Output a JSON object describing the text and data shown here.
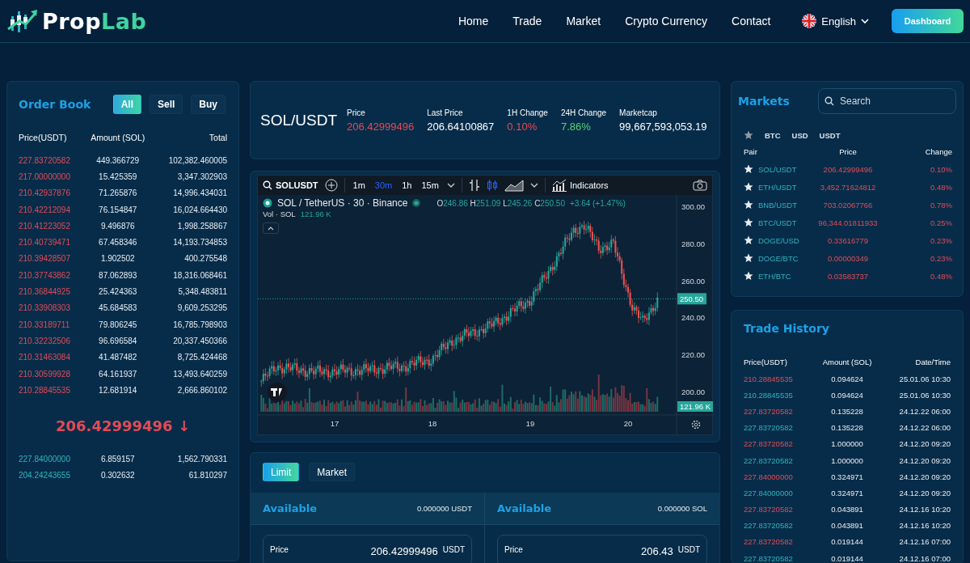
{
  "header": {
    "brand": [
      "Prop",
      "Lab"
    ],
    "nav": [
      {
        "label": "Home"
      },
      {
        "label": "Trade"
      },
      {
        "label": "Market"
      },
      {
        "label": "Crypto Currency"
      },
      {
        "label": "Contact"
      }
    ],
    "language": "English",
    "dashboard_button": "Dashboard"
  },
  "order_book": {
    "title": "Order Book",
    "filters": [
      {
        "label": "All",
        "selected": true
      },
      {
        "label": "Sell",
        "selected": false
      },
      {
        "label": "Buy",
        "selected": false
      }
    ],
    "columns": [
      "Price(USDT)",
      "Amount (SOL)",
      "Total"
    ],
    "asks": [
      {
        "price": "227.83720582",
        "amount": "449.366729",
        "total": "102,382.460005",
        "kind": "sell"
      },
      {
        "price": "217.00000000",
        "amount": "15.425359",
        "total": "3,347.302903",
        "kind": "sell"
      },
      {
        "price": "210.42937876",
        "amount": "71.265876",
        "total": "14,996.434031",
        "kind": "sell"
      },
      {
        "price": "210.42212094",
        "amount": "76.154847",
        "total": "16,024.664430",
        "kind": "sell"
      },
      {
        "price": "210.41223052",
        "amount": "9.496876",
        "total": "1,998.258867",
        "kind": "sell"
      },
      {
        "price": "210.40739471",
        "amount": "67.458346",
        "total": "14,193.734853",
        "kind": "sell"
      },
      {
        "price": "210.39428507",
        "amount": "1.902502",
        "total": "400.275548",
        "kind": "sell"
      },
      {
        "price": "210.37743862",
        "amount": "87.062893",
        "total": "18,316.068461",
        "kind": "sell"
      },
      {
        "price": "210.36844925",
        "amount": "25.424363",
        "total": "5,348.483811",
        "kind": "sell"
      },
      {
        "price": "210.33908303",
        "amount": "45.684583",
        "total": "9,609.253295",
        "kind": "sell"
      },
      {
        "price": "210.33189711",
        "amount": "79.806245",
        "total": "16,785.798903",
        "kind": "sell"
      },
      {
        "price": "210.32232506",
        "amount": "96.696584",
        "total": "20,337.450366",
        "kind": "sell"
      },
      {
        "price": "210.31463084",
        "amount": "41.487482",
        "total": "8,725.424468",
        "kind": "sell"
      },
      {
        "price": "210.30599928",
        "amount": "64.161937",
        "total": "13,493.640259",
        "kind": "sell"
      },
      {
        "price": "210.28845535",
        "amount": "12.681914",
        "total": "2,666.860102",
        "kind": "sell"
      }
    ],
    "last_price": {
      "value": "206.42999496",
      "arrow": "↓",
      "kind": "down"
    },
    "bids": [
      {
        "price": "227.84000000",
        "amount": "6.859157",
        "total": "1,562.790331",
        "kind": "buy"
      },
      {
        "price": "204.24243655",
        "amount": "0.302632",
        "total": "61.810297",
        "kind": "buy"
      }
    ]
  },
  "ticker": {
    "symbol": "SOL/USDT",
    "stats": [
      {
        "label": "Price",
        "value": "206.42999496",
        "kind": "down"
      },
      {
        "label": "Last Price",
        "value": "206.64100867",
        "kind": "neutral"
      },
      {
        "label": "1H Change",
        "value": "0.10%",
        "kind": "down"
      },
      {
        "label": "24H Change",
        "value": "7.86%",
        "kind": "up"
      },
      {
        "label": "Marketcap",
        "value": "99,667,593,053.19",
        "kind": "neutral"
      }
    ]
  },
  "chart": {
    "symbol": "SOLUSDT",
    "intervals": [
      {
        "label": "1m",
        "selected": false
      },
      {
        "label": "30m",
        "selected": true
      },
      {
        "label": "1h",
        "selected": false
      },
      {
        "label": "15m",
        "selected": false
      }
    ],
    "indicators": "Indicators",
    "title": "SOL / TetherUS · 30 · Binance",
    "ohlc": [
      {
        "key": "O",
        "value": "246.86"
      },
      {
        "key": "H",
        "value": "251.09"
      },
      {
        "key": "L",
        "value": "245.26"
      },
      {
        "key": "C",
        "value": "250.50"
      }
    ],
    "change": "+3.64 (+1.47%)",
    "volume_label": "Vol · SOL",
    "volume_value": "121.96 K",
    "y_labels": [
      "300.00",
      "280.00",
      "260.00",
      "240.00",
      "220.00",
      "200.00"
    ],
    "x_labels": [
      "17",
      "18",
      "19",
      "20"
    ],
    "price_tag": "250.50",
    "volume_tag": "121.96 K"
  },
  "order_form": {
    "types": [
      {
        "label": "Limit",
        "selected": true
      },
      {
        "label": "Market",
        "selected": false
      }
    ],
    "sides": [
      {
        "title": "Available",
        "balance": "0.000000 USDT",
        "price_label": "Price",
        "price": "206.42999496",
        "unit": "USDT"
      },
      {
        "title": "Available",
        "balance": "0.000000 SOL",
        "price_label": "Price",
        "price": "206.43",
        "unit": "USDT"
      }
    ]
  },
  "markets": {
    "title": "Markets",
    "search": {
      "placeholder": "Search"
    },
    "filters": [
      {
        "label": "BTC"
      },
      {
        "label": "USD"
      },
      {
        "label": "USDT"
      }
    ],
    "columns": [
      "Pair",
      "Price",
      "Change"
    ],
    "rows": [
      {
        "pair": "SOL/USDT",
        "price": "206.42999496",
        "change": "0.10%"
      },
      {
        "pair": "ETH/USDT",
        "price": "3,452.71624812",
        "change": "0.48%"
      },
      {
        "pair": "BNB/USDT",
        "price": "703.02067766",
        "change": "0.78%"
      },
      {
        "pair": "BTC/USDT",
        "price": "96,344.01811933",
        "change": "0.25%"
      },
      {
        "pair": "DOGE/USD",
        "price": "0.33616779",
        "change": "0.23%"
      },
      {
        "pair": "DOGE/BTC",
        "price": "0.00000349",
        "change": "0.23%"
      },
      {
        "pair": "ETH/BTC",
        "price": "0.03583737",
        "change": "0.48%"
      }
    ]
  },
  "trade_history": {
    "title": "Trade History",
    "columns": [
      "Price(USDT)",
      "Amount (SOL)",
      "Date/Time"
    ],
    "rows": [
      {
        "price": "210.28845535",
        "amount": "0.094624",
        "time": "25.01.06 10:30",
        "kind": "sell"
      },
      {
        "price": "210.28845535",
        "amount": "0.094624",
        "time": "25.01.06 10:30",
        "kind": "buy"
      },
      {
        "price": "227.83720582",
        "amount": "0.135228",
        "time": "24.12.22 06:00",
        "kind": "sell"
      },
      {
        "price": "227.83720582",
        "amount": "0.135228",
        "time": "24.12.22 06:00",
        "kind": "buy"
      },
      {
        "price": "227.83720582",
        "amount": "1.000000",
        "time": "24.12.20 09:20",
        "kind": "sell"
      },
      {
        "price": "227.83720582",
        "amount": "1.000000",
        "time": "24.12.20 09:20",
        "kind": "buy"
      },
      {
        "price": "227.84000000",
        "amount": "0.324971",
        "time": "24.12.20 09:20",
        "kind": "sell"
      },
      {
        "price": "227.84000000",
        "amount": "0.324971",
        "time": "24.12.20 09:20",
        "kind": "buy"
      },
      {
        "price": "227.83720582",
        "amount": "0.043891",
        "time": "24.12.16 10:20",
        "kind": "sell"
      },
      {
        "price": "227.83720582",
        "amount": "0.043891",
        "time": "24.12.16 10:20",
        "kind": "buy"
      },
      {
        "price": "227.83720582",
        "amount": "0.019144",
        "time": "24.12.16 07:00",
        "kind": "sell"
      },
      {
        "price": "227.83720582",
        "amount": "0.019144",
        "time": "24.12.16 07:00",
        "kind": "buy"
      }
    ]
  }
}
